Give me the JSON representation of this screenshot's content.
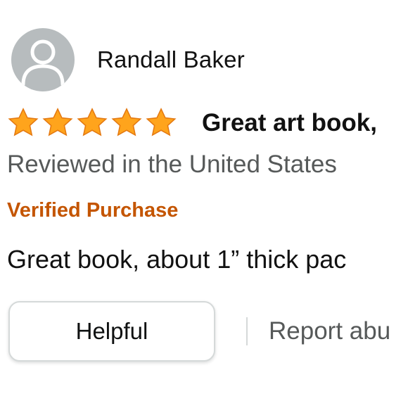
{
  "reviewer": {
    "name": "Randall Baker",
    "avatar_icon": "person-silhouette-icon",
    "avatar_color": "#b7bcbe"
  },
  "rating": {
    "stars": 5,
    "max_stars": 5,
    "star_color": "#ffa41c",
    "star_icon": "star-icon"
  },
  "review": {
    "title": "Great art book,",
    "reviewed_in": "Reviewed in the United States",
    "verified_label": "Verified Purchase",
    "verified_color": "#c45500",
    "body": "Great book, about 1” thick pac"
  },
  "actions": {
    "helpful_label": "Helpful",
    "report_label": "Report abu"
  }
}
